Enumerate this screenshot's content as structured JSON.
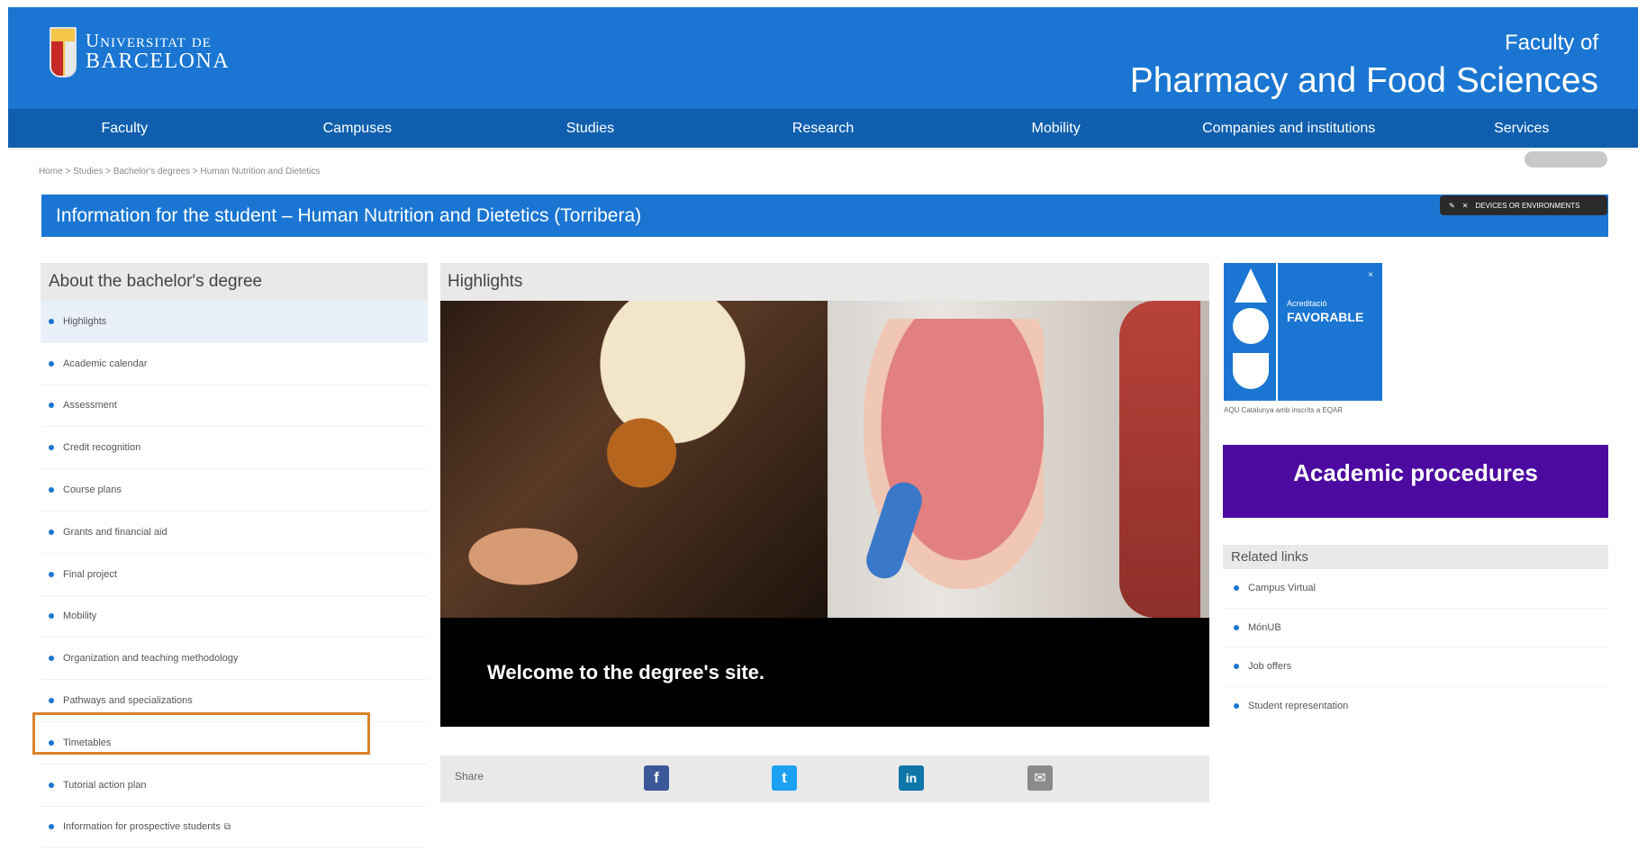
{
  "header": {
    "university_line1": "Universitat de",
    "university_line2": "BARCELONA",
    "faculty_small": "Faculty of",
    "faculty_big": "Pharmacy and Food Sciences"
  },
  "nav": [
    "Faculty",
    "Campuses",
    "Studies",
    "Research",
    "Mobility",
    "Companies and institutions",
    "Services"
  ],
  "breadcrumb": "Home > Studies > Bachelor's degrees > Human Nutrition and Dietetics",
  "info_bar": {
    "title": "Information for the student – Human Nutrition and Dietetics (Torribera)",
    "tools": "DEVICES OR ENVIRONMENTS"
  },
  "left_menu": {
    "title": "About the bachelor's degree",
    "items": [
      "Highlights",
      "Academic calendar",
      "Assessment",
      "Credit recognition",
      "Course plans",
      "Grants and financial aid",
      "Final project",
      "Mobility",
      "Organization and teaching methodology",
      "Pathways and specializations",
      "Timetables",
      "Tutorial action plan",
      "Information for prospective students"
    ]
  },
  "highlights": {
    "title": "Highlights",
    "caption": "Welcome to the degree's site.",
    "share_label": "Share"
  },
  "aqu": {
    "label1": "Acreditació",
    "label2": "FAVORABLE",
    "code": "",
    "caption": "AQU Catalunya amb inscrits a EQAR",
    "close": "×"
  },
  "academic_procedures": "Academic procedures",
  "related": {
    "title": "Related links",
    "items": [
      "Campus Virtual",
      "MónUB",
      "Job offers",
      "Student representation"
    ]
  },
  "colors": {
    "header_blue": "#1a76d2",
    "nav_blue": "#0f5fae",
    "academic_purple": "#4c0aa0",
    "highlight_border": "#d9832a"
  }
}
